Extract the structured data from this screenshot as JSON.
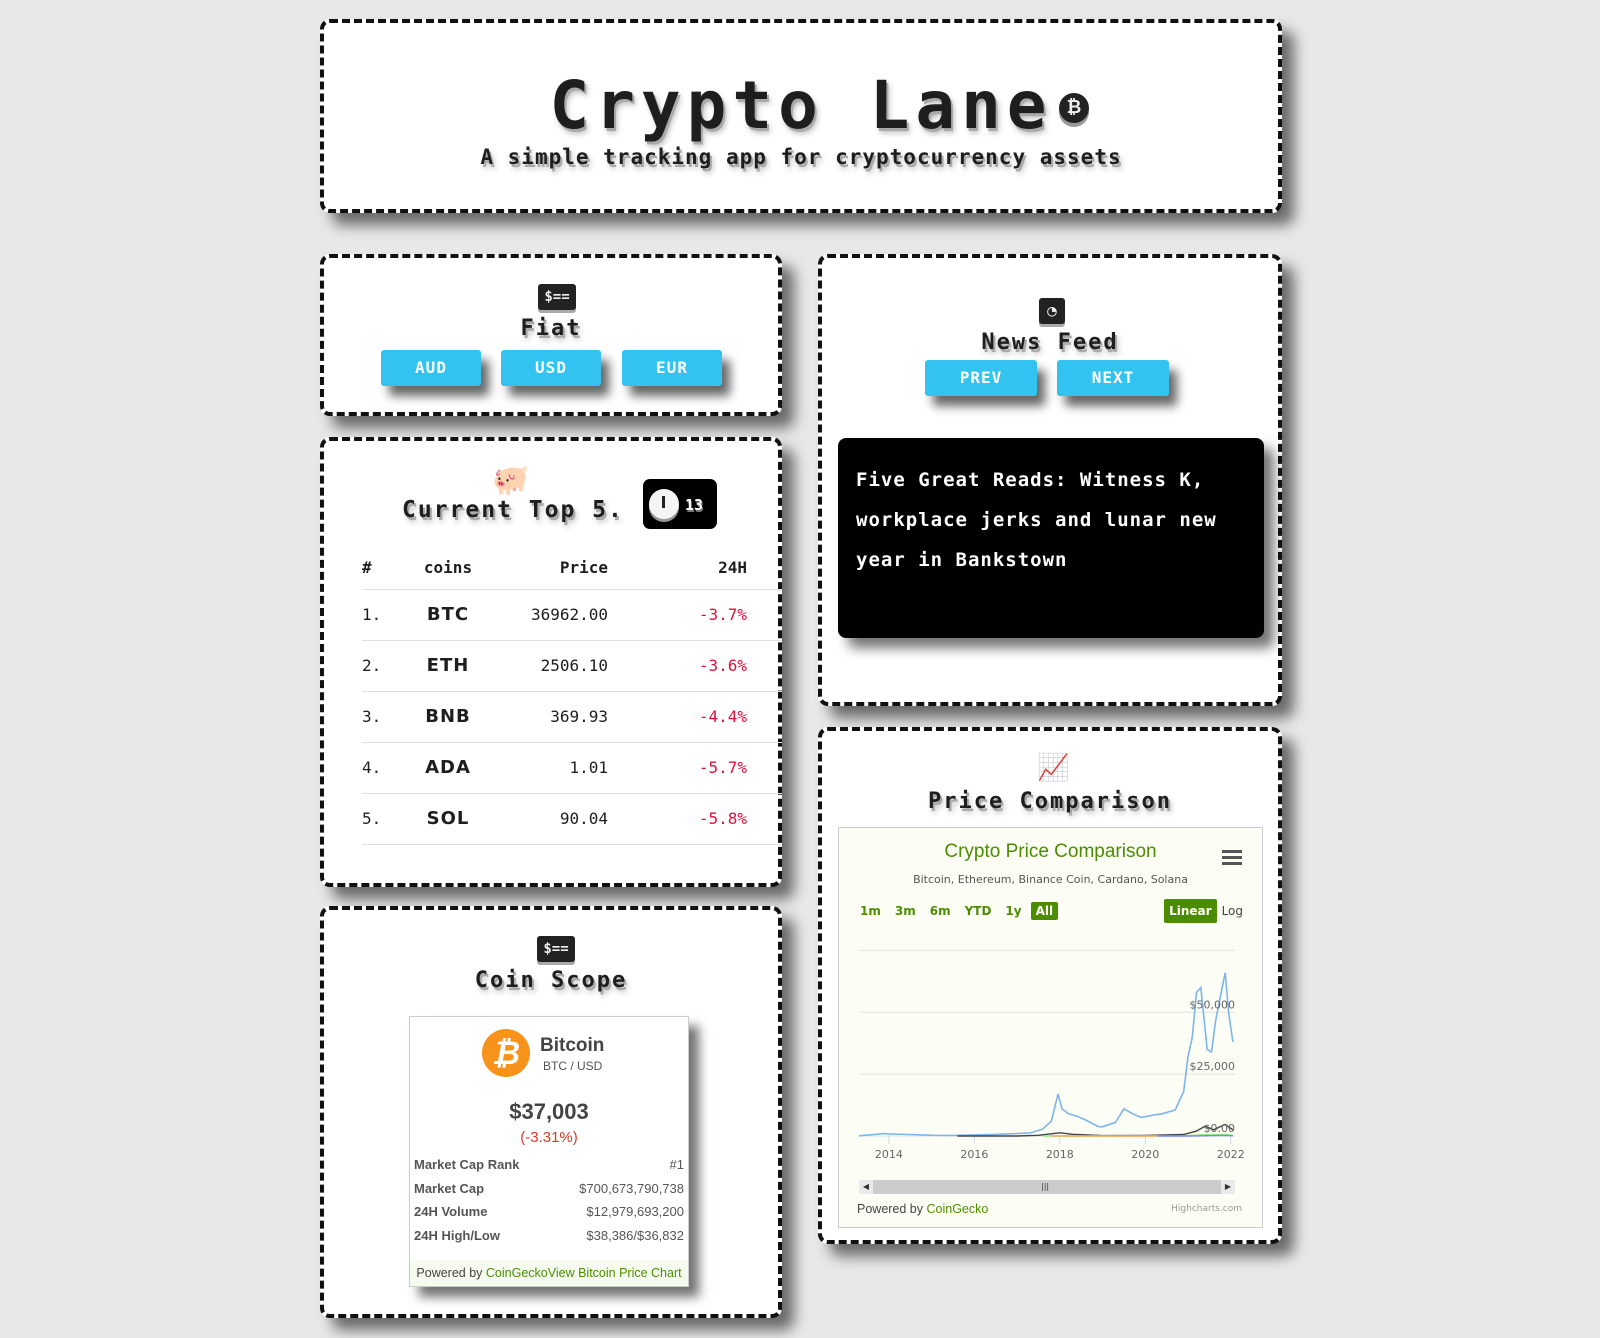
{
  "header": {
    "title": "Crypto Lane",
    "badge_icon": "bitcoin-icon",
    "subtitle": "A simple tracking app for cryptocurrency assets"
  },
  "fiat": {
    "icon": "money-bill-icon",
    "icon_text": "$==",
    "heading": "Fiat",
    "buttons": [
      "AUD",
      "USD",
      "EUR"
    ]
  },
  "top5": {
    "icon": "piggy-bank-icon",
    "heading": "Current Top 5.",
    "timer": {
      "icon": "clock-icon",
      "value": "13"
    },
    "columns": [
      "#",
      "coins",
      "Price",
      "24H"
    ],
    "rows": [
      {
        "rank": "1.",
        "coin": "BTC",
        "price": "36962.00",
        "change": "-3.7%"
      },
      {
        "rank": "2.",
        "coin": "ETH",
        "price": "2506.10",
        "change": "-3.6%"
      },
      {
        "rank": "3.",
        "coin": "BNB",
        "price": "369.93",
        "change": "-4.4%"
      },
      {
        "rank": "4.",
        "coin": "ADA",
        "price": "1.01",
        "change": "-5.7%"
      },
      {
        "rank": "5.",
        "coin": "SOL",
        "price": "90.04",
        "change": "-5.8%"
      }
    ],
    "negative_color": "#e0113d"
  },
  "coin_scope": {
    "icon": "money-bill-icon",
    "icon_text": "$==",
    "heading": "Coin Scope",
    "widget": {
      "logo_glyph": "₿",
      "name": "Bitcoin",
      "pair": "BTC / USD",
      "price": "$37,003",
      "change": "(-3.31%)",
      "stats": [
        {
          "label": "Market Cap Rank",
          "value": "#1"
        },
        {
          "label": "Market Cap",
          "value": "$700,673,790,738"
        },
        {
          "label": "24H Volume",
          "value": "$12,979,693,200"
        },
        {
          "label": "24H High/Low",
          "value": "$38,386/$36,832"
        }
      ],
      "footer_prefix": "Powered by ",
      "footer_brand": "CoinGecko",
      "footer_link": "View Bitcoin Price Chart"
    }
  },
  "news": {
    "icon": "rss-icon",
    "heading": "News Feed",
    "prev_label": "PREV",
    "next_label": "NEXT",
    "article_title": "Five Great Reads: Witness K, workplace jerks and lunar new year in Bankstown"
  },
  "price_comparison": {
    "icon": "chart-line-icon",
    "heading": "Price Comparison",
    "ranges": [
      "1m",
      "3m",
      "6m",
      "YTD",
      "1y",
      "All"
    ],
    "active_range": "All",
    "scales": [
      "Linear",
      "Log"
    ],
    "active_scale": "Linear",
    "menu_icon": "hamburger-menu-icon",
    "powered_prefix": "Powered by ",
    "powered_brand": "CoinGecko",
    "credit": "Highcharts.com"
  },
  "chart_data": {
    "type": "line",
    "title": "Crypto Price Comparison",
    "subtitle": "Bitcoin, Ethereum, Binance Coin, Cardano, Solana",
    "xlabel": "",
    "ylabel": "",
    "x_ticks": [
      "2014",
      "2016",
      "2018",
      "2020",
      "2022"
    ],
    "y_ticks": [
      "$0.00",
      "$25,000",
      "$50,000"
    ],
    "xlim": [
      2013.3,
      2022.1
    ],
    "ylim": [
      0,
      80000
    ],
    "grid": true,
    "series": [
      {
        "name": "Bitcoin",
        "color": "#7cb5ec",
        "x": [
          2013.3,
          2013.9,
          2014.0,
          2014.5,
          2015.0,
          2015.5,
          2016.0,
          2016.5,
          2017.0,
          2017.3,
          2017.6,
          2017.8,
          2017.96,
          2018.05,
          2018.2,
          2018.4,
          2018.6,
          2018.9,
          2019.0,
          2019.3,
          2019.5,
          2019.7,
          2019.9,
          2020.2,
          2020.4,
          2020.7,
          2020.9,
          2021.0,
          2021.1,
          2021.2,
          2021.3,
          2021.45,
          2021.55,
          2021.65,
          2021.8,
          2021.87,
          2021.95,
          2022.05
        ],
        "values": [
          100,
          1000,
          800,
          600,
          300,
          250,
          430,
          650,
          1000,
          1200,
          2800,
          6000,
          17000,
          11000,
          9000,
          8000,
          6500,
          3800,
          3700,
          5500,
          11000,
          9000,
          7500,
          8500,
          9000,
          10500,
          18000,
          32000,
          40000,
          58000,
          60000,
          35000,
          34000,
          47000,
          60000,
          66000,
          50000,
          38000
        ]
      },
      {
        "name": "Ethereum",
        "color": "#434348",
        "x": [
          2015.6,
          2017.0,
          2017.5,
          2018.0,
          2018.3,
          2019.0,
          2020.0,
          2020.9,
          2021.2,
          2021.4,
          2021.6,
          2021.87,
          2022.05
        ],
        "values": [
          1,
          10,
          300,
          1300,
          700,
          150,
          200,
          600,
          2000,
          4000,
          2500,
          4700,
          2500
        ]
      },
      {
        "name": "Binance Coin",
        "color": "#90ed7d",
        "x": [
          2017.6,
          2020.9,
          2021.3,
          2021.8,
          2022.05
        ],
        "values": [
          1,
          30,
          500,
          600,
          370
        ]
      },
      {
        "name": "Cardano",
        "color": "#f7a35c",
        "x": [
          2017.8,
          2018.0,
          2019.0,
          2020.0,
          2020.3
        ],
        "values": [
          0.02,
          0.7,
          0.04,
          0.05,
          0.04
        ]
      },
      {
        "name": "Solana",
        "color": "#8085e9",
        "x": [
          2020.3,
          2021.0,
          2021.7,
          2021.9,
          2022.05
        ],
        "values": [
          1,
          2,
          150,
          220,
          90
        ]
      }
    ]
  }
}
